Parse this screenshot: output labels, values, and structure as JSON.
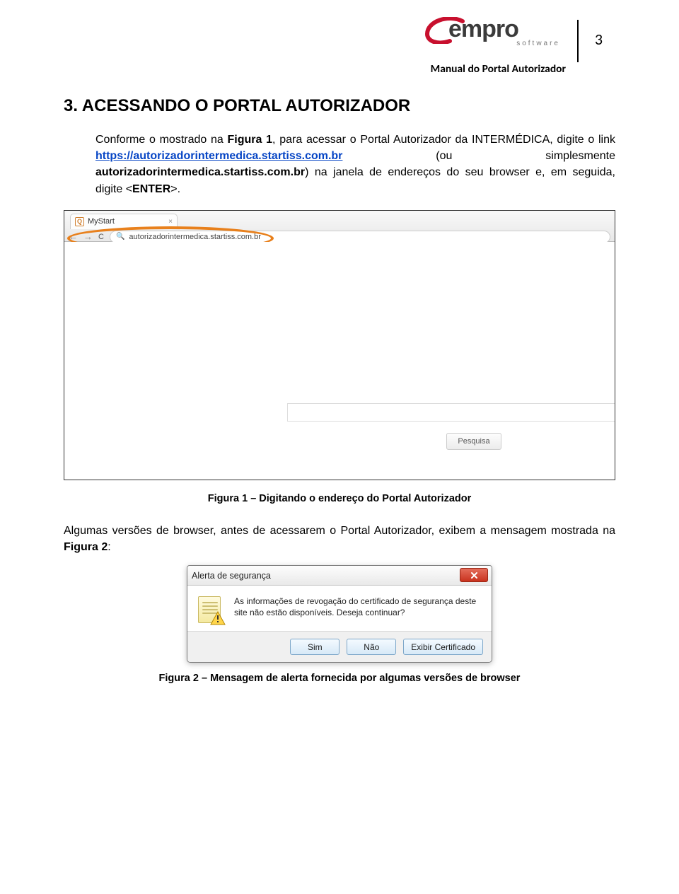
{
  "header": {
    "logo_text": "empro",
    "logo_sub": "software",
    "manual_title": "Manual do Portal Autorizador",
    "page_number": "3"
  },
  "section_heading": "3. ACESSANDO O PORTAL AUTORIZADOR",
  "para1": {
    "p1": "Conforme o mostrado na ",
    "fig1": "Figura 1",
    "p2": ", para acessar o Portal Autorizador da INTERMÉDICA, digite o link ",
    "link_text": "https://autorizadorintermedica.startiss.com.br",
    "p3": " (ou simplesmente ",
    "bold1": "autorizadorintermedica.startiss.com.br",
    "p4": ") na janela de endereços do seu browser e, em seguida, digite <",
    "enter": "ENTER",
    "p5": ">."
  },
  "browser": {
    "tab_label": "MyStart",
    "address_text": "autorizadorintermedica.startiss.com.br",
    "search_button": "Pesquisa"
  },
  "caption1": "Figura 1 – Digitando o endereço do Portal Autorizador",
  "para2": {
    "p1": "Algumas versões de browser, antes de acessarem o Portal Autorizador, exibem a mensagem mostrada na ",
    "fig2": "Figura 2",
    "p2": ":"
  },
  "dialog": {
    "title": "Alerta de segurança",
    "message": "As informações de revogação do certificado de segurança deste site não estão disponíveis. Deseja continuar?",
    "btn_yes": "Sim",
    "btn_no": "Não",
    "btn_cert": "Exibir Certificado"
  },
  "caption2": "Figura 2 – Mensagem de alerta fornecida por algumas versões de browser"
}
